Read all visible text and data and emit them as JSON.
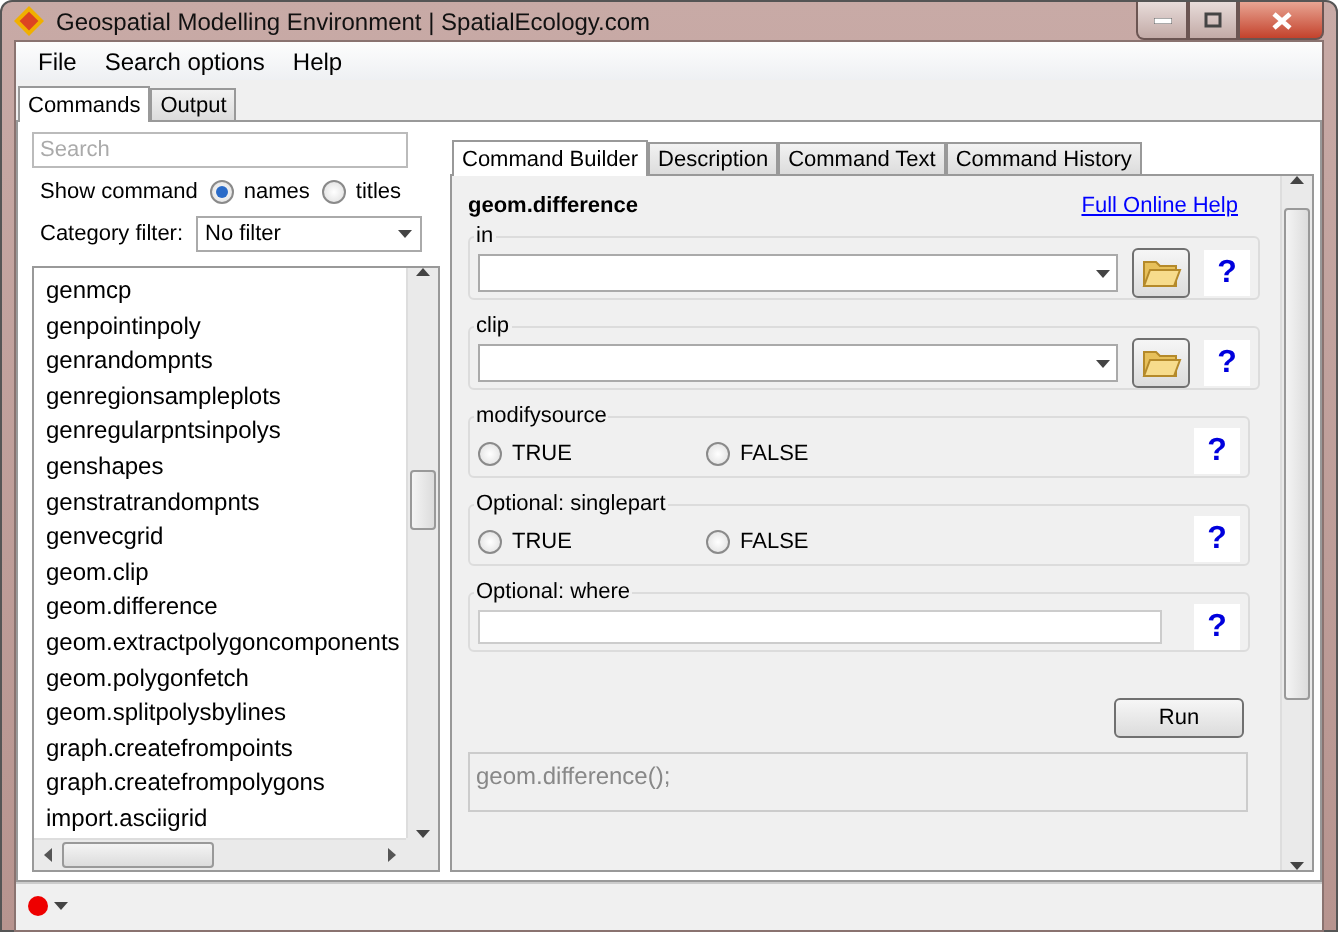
{
  "window": {
    "title": "Geospatial Modelling Environment | SpatialEcology.com"
  },
  "menu": [
    "File",
    "Search options",
    "Help"
  ],
  "main_tabs": [
    {
      "label": "Commands",
      "selected": true
    },
    {
      "label": "Output",
      "selected": false
    }
  ],
  "commands_panel": {
    "search": {
      "placeholder": "Search"
    },
    "show_command": {
      "label": "Show command",
      "options": [
        {
          "label": "names",
          "selected": true
        },
        {
          "label": "titles",
          "selected": false
        }
      ]
    },
    "category_filter": {
      "label": "Category filter:",
      "value": "No filter"
    },
    "commands": [
      "genmcp",
      "genpointinpoly",
      "genrandompnts",
      "genregionsampleplots",
      "genregularpntsinpolys",
      "genshapes",
      "genstratrandompnts",
      "genvecgrid",
      "geom.clip",
      "geom.difference",
      "geom.extractpolygoncomponents",
      "geom.polygonfetch",
      "geom.splitpolysbylines",
      "graph.createfrompoints",
      "graph.createfrompolygons",
      "import.asciigrid"
    ]
  },
  "builder_tabs": [
    {
      "label": "Command Builder",
      "selected": true
    },
    {
      "label": "Description",
      "selected": false
    },
    {
      "label": "Command Text",
      "selected": false
    },
    {
      "label": "Command History",
      "selected": false
    }
  ],
  "builder": {
    "command": "geom.difference",
    "help_link": "Full Online Help",
    "params": [
      {
        "kind": "file",
        "label": "in",
        "help": "?"
      },
      {
        "kind": "file",
        "label": "clip",
        "help": "?"
      },
      {
        "kind": "boolean",
        "label": "modifysource",
        "help": "?",
        "options": [
          {
            "label": "TRUE",
            "selected": false
          },
          {
            "label": "FALSE",
            "selected": false
          }
        ]
      },
      {
        "kind": "boolean",
        "label": "Optional: singlepart",
        "help": "?",
        "options": [
          {
            "label": "TRUE",
            "selected": false
          },
          {
            "label": "FALSE",
            "selected": false
          }
        ]
      },
      {
        "kind": "text",
        "label": "Optional: where",
        "help": "?"
      }
    ],
    "run_button": "Run",
    "command_text": "geom.difference();"
  }
}
